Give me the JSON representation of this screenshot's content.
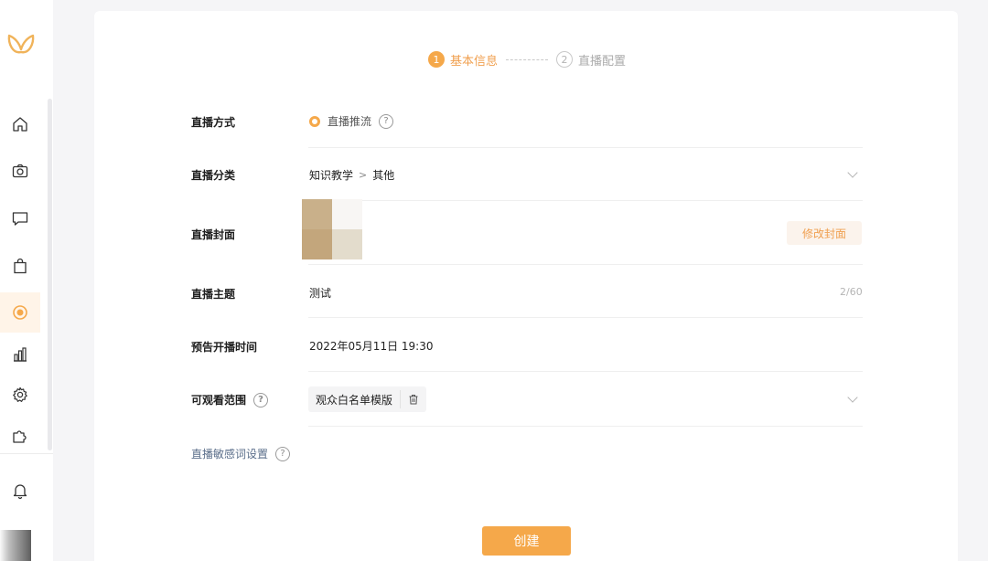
{
  "sidebar": {
    "items": [
      {
        "name": "home-icon"
      },
      {
        "name": "camera-icon"
      },
      {
        "name": "message-icon"
      },
      {
        "name": "shopping-bag-icon"
      },
      {
        "name": "live-icon",
        "active": true
      },
      {
        "name": "bar-chart-icon"
      },
      {
        "name": "gear-icon"
      },
      {
        "name": "puzzle-icon"
      },
      {
        "name": "bell-icon"
      }
    ]
  },
  "steps": [
    {
      "number": "1",
      "label": "基本信息",
      "active": true
    },
    {
      "number": "2",
      "label": "直播配置",
      "active": false
    }
  ],
  "form": {
    "method": {
      "label": "直播方式",
      "option": "直播推流",
      "help": "?"
    },
    "category": {
      "label": "直播分类",
      "primary": "知识教学",
      "separator": ">",
      "secondary": "其他"
    },
    "cover": {
      "label": "直播封面",
      "button": "修改封面"
    },
    "topic": {
      "label": "直播主题",
      "value": "测试",
      "counter": "2/60"
    },
    "schedule": {
      "label": "预告开播时间",
      "value": "2022年05月11日 19:30"
    },
    "scope": {
      "label": "可观看范围",
      "help": "?",
      "tag": "观众白名单模版"
    },
    "sensitive_words": {
      "label": "直播敏感词设置",
      "help": "?"
    }
  },
  "actions": {
    "create": "创建"
  },
  "colors": {
    "accent": "#f5a84a",
    "accent_text": "#f0a050",
    "link": "#5a6e8a"
  }
}
